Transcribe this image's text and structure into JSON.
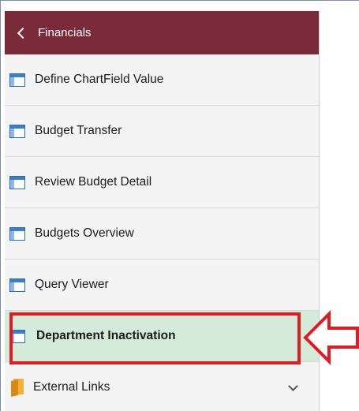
{
  "nav": {
    "back_label": "Financials",
    "items": [
      {
        "label": "Define ChartField Value",
        "icon": "page-icon"
      },
      {
        "label": "Budget Transfer",
        "icon": "page-icon"
      },
      {
        "label": "Review Budget Detail",
        "icon": "page-icon"
      },
      {
        "label": "Budgets Overview",
        "icon": "page-icon"
      },
      {
        "label": "Query Viewer",
        "icon": "page-icon"
      },
      {
        "label": "Department Inactivation",
        "icon": "page-icon",
        "active": true
      },
      {
        "label": "External Links",
        "icon": "folder-icon",
        "expandable": true
      }
    ]
  },
  "colors": {
    "header_bg": "#7b2a3a",
    "active_bg": "#d3ebd8",
    "highlight": "#e01b24"
  }
}
